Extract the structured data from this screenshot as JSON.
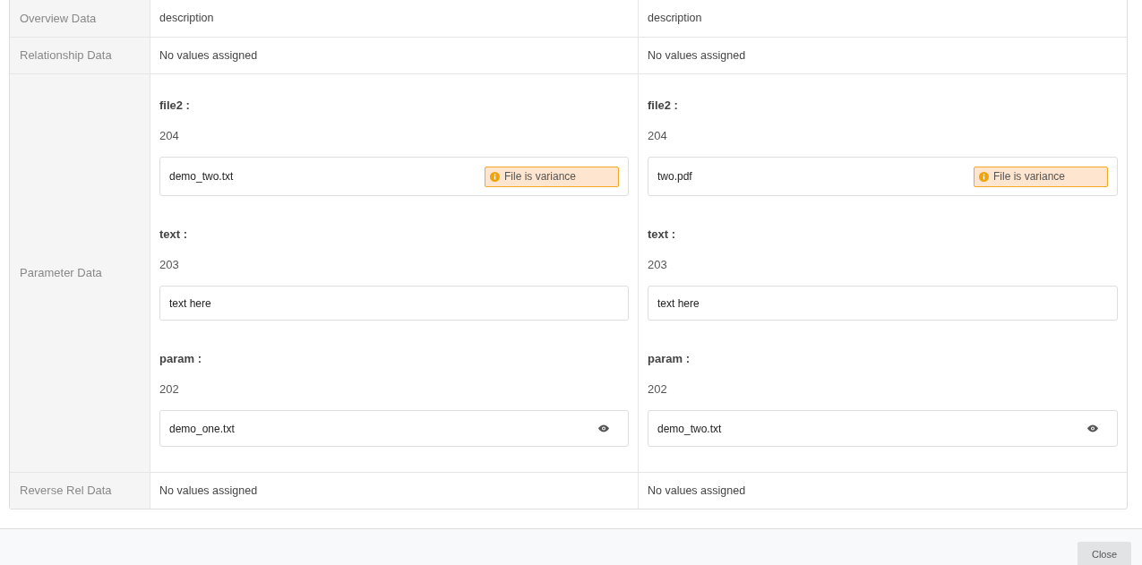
{
  "rows": [
    {
      "label": "Overview Data",
      "kind": "text",
      "cells": [
        "description",
        "description"
      ]
    },
    {
      "label": "Relationship Data",
      "kind": "text",
      "cells": [
        "No values assigned",
        "No values assigned"
      ]
    },
    {
      "label": "Parameter Data",
      "kind": "params",
      "cells": [
        [
          {
            "name": "file2 :",
            "value": "204",
            "field": {
              "kind": "badge",
              "text": "demo_two.txt",
              "badge": "File is variance"
            }
          },
          {
            "name": "text :",
            "value": "203",
            "field": {
              "kind": "plain",
              "text": "text here"
            }
          },
          {
            "name": "param :",
            "value": "202",
            "field": {
              "kind": "view",
              "text": "demo_one.txt"
            }
          }
        ],
        [
          {
            "name": "file2 :",
            "value": "204",
            "field": {
              "kind": "badge",
              "text": "two.pdf",
              "badge": "File is variance"
            }
          },
          {
            "name": "text :",
            "value": "203",
            "field": {
              "kind": "plain",
              "text": "text here"
            }
          },
          {
            "name": "param :",
            "value": "202",
            "field": {
              "kind": "view",
              "text": "demo_two.txt"
            }
          }
        ]
      ]
    },
    {
      "label": "Reverse Rel Data",
      "kind": "text",
      "cells": [
        "No values assigned",
        "No values assigned"
      ]
    }
  ],
  "footer": {
    "button": "Close"
  }
}
